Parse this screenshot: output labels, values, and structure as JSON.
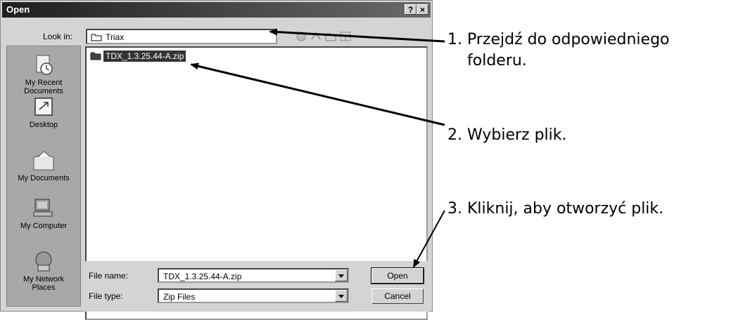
{
  "dialog": {
    "title": "Open",
    "help_button": "?",
    "close_button": "×",
    "look_in_label": "Look in:",
    "look_in_value": "Triax",
    "places": [
      {
        "label": "My Recent Documents",
        "icon": "recent-documents-icon"
      },
      {
        "label": "Desktop",
        "icon": "desktop-icon"
      },
      {
        "label": "My Documents",
        "icon": "my-documents-icon"
      },
      {
        "label": "My Computer",
        "icon": "my-computer-icon"
      },
      {
        "label": "My Network Places",
        "icon": "network-places-icon"
      }
    ],
    "files": [
      {
        "name": "TDX_1.3.25.44-A.zip",
        "selected": true
      }
    ],
    "file_name_label": "File name:",
    "file_name_value": "TDX_1.3.25.44-A.zip",
    "file_type_label": "File type:",
    "file_type_value": "Zip Files",
    "open_button": "Open",
    "cancel_button": "Cancel"
  },
  "annotations": {
    "step1_line1": "1. Przejdź do odpowiedniego",
    "step1_line2": "folderu.",
    "step2": "2. Wybierz plik.",
    "step3": "3. Kliknij, aby otworzyć plik."
  }
}
